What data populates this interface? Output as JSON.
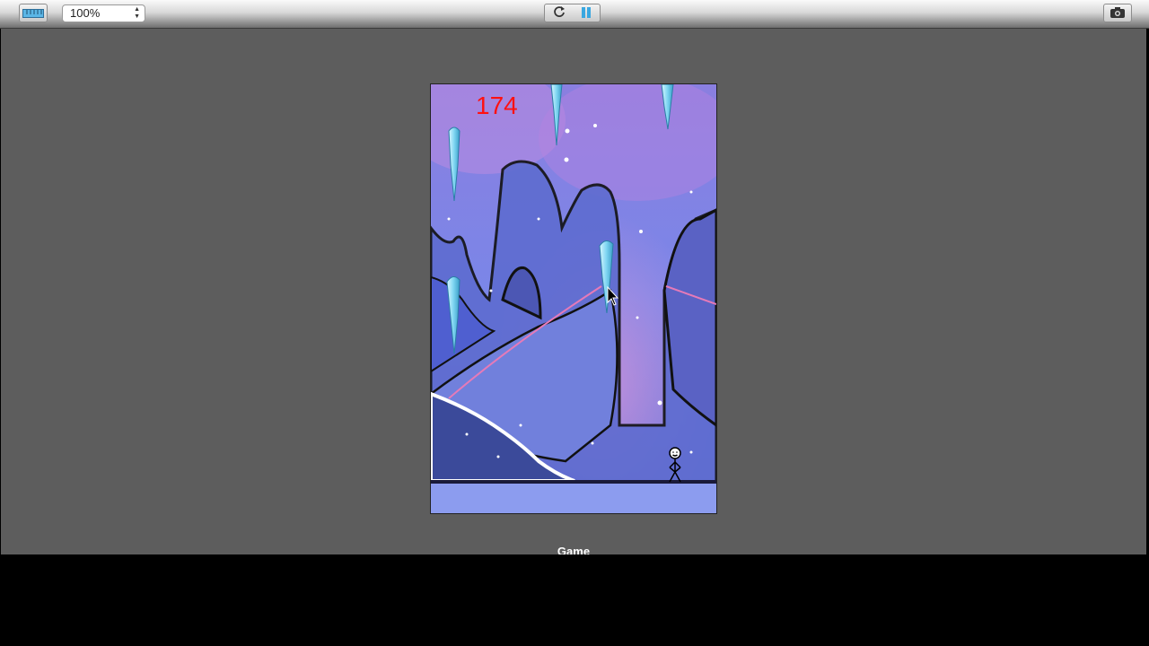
{
  "toolbar": {
    "zoom_value": "100%",
    "icons": [
      "ruler-icon",
      "refresh-icon",
      "pause-icon",
      "camera-icon"
    ]
  },
  "game": {
    "score": "174",
    "caption": "Game"
  }
}
